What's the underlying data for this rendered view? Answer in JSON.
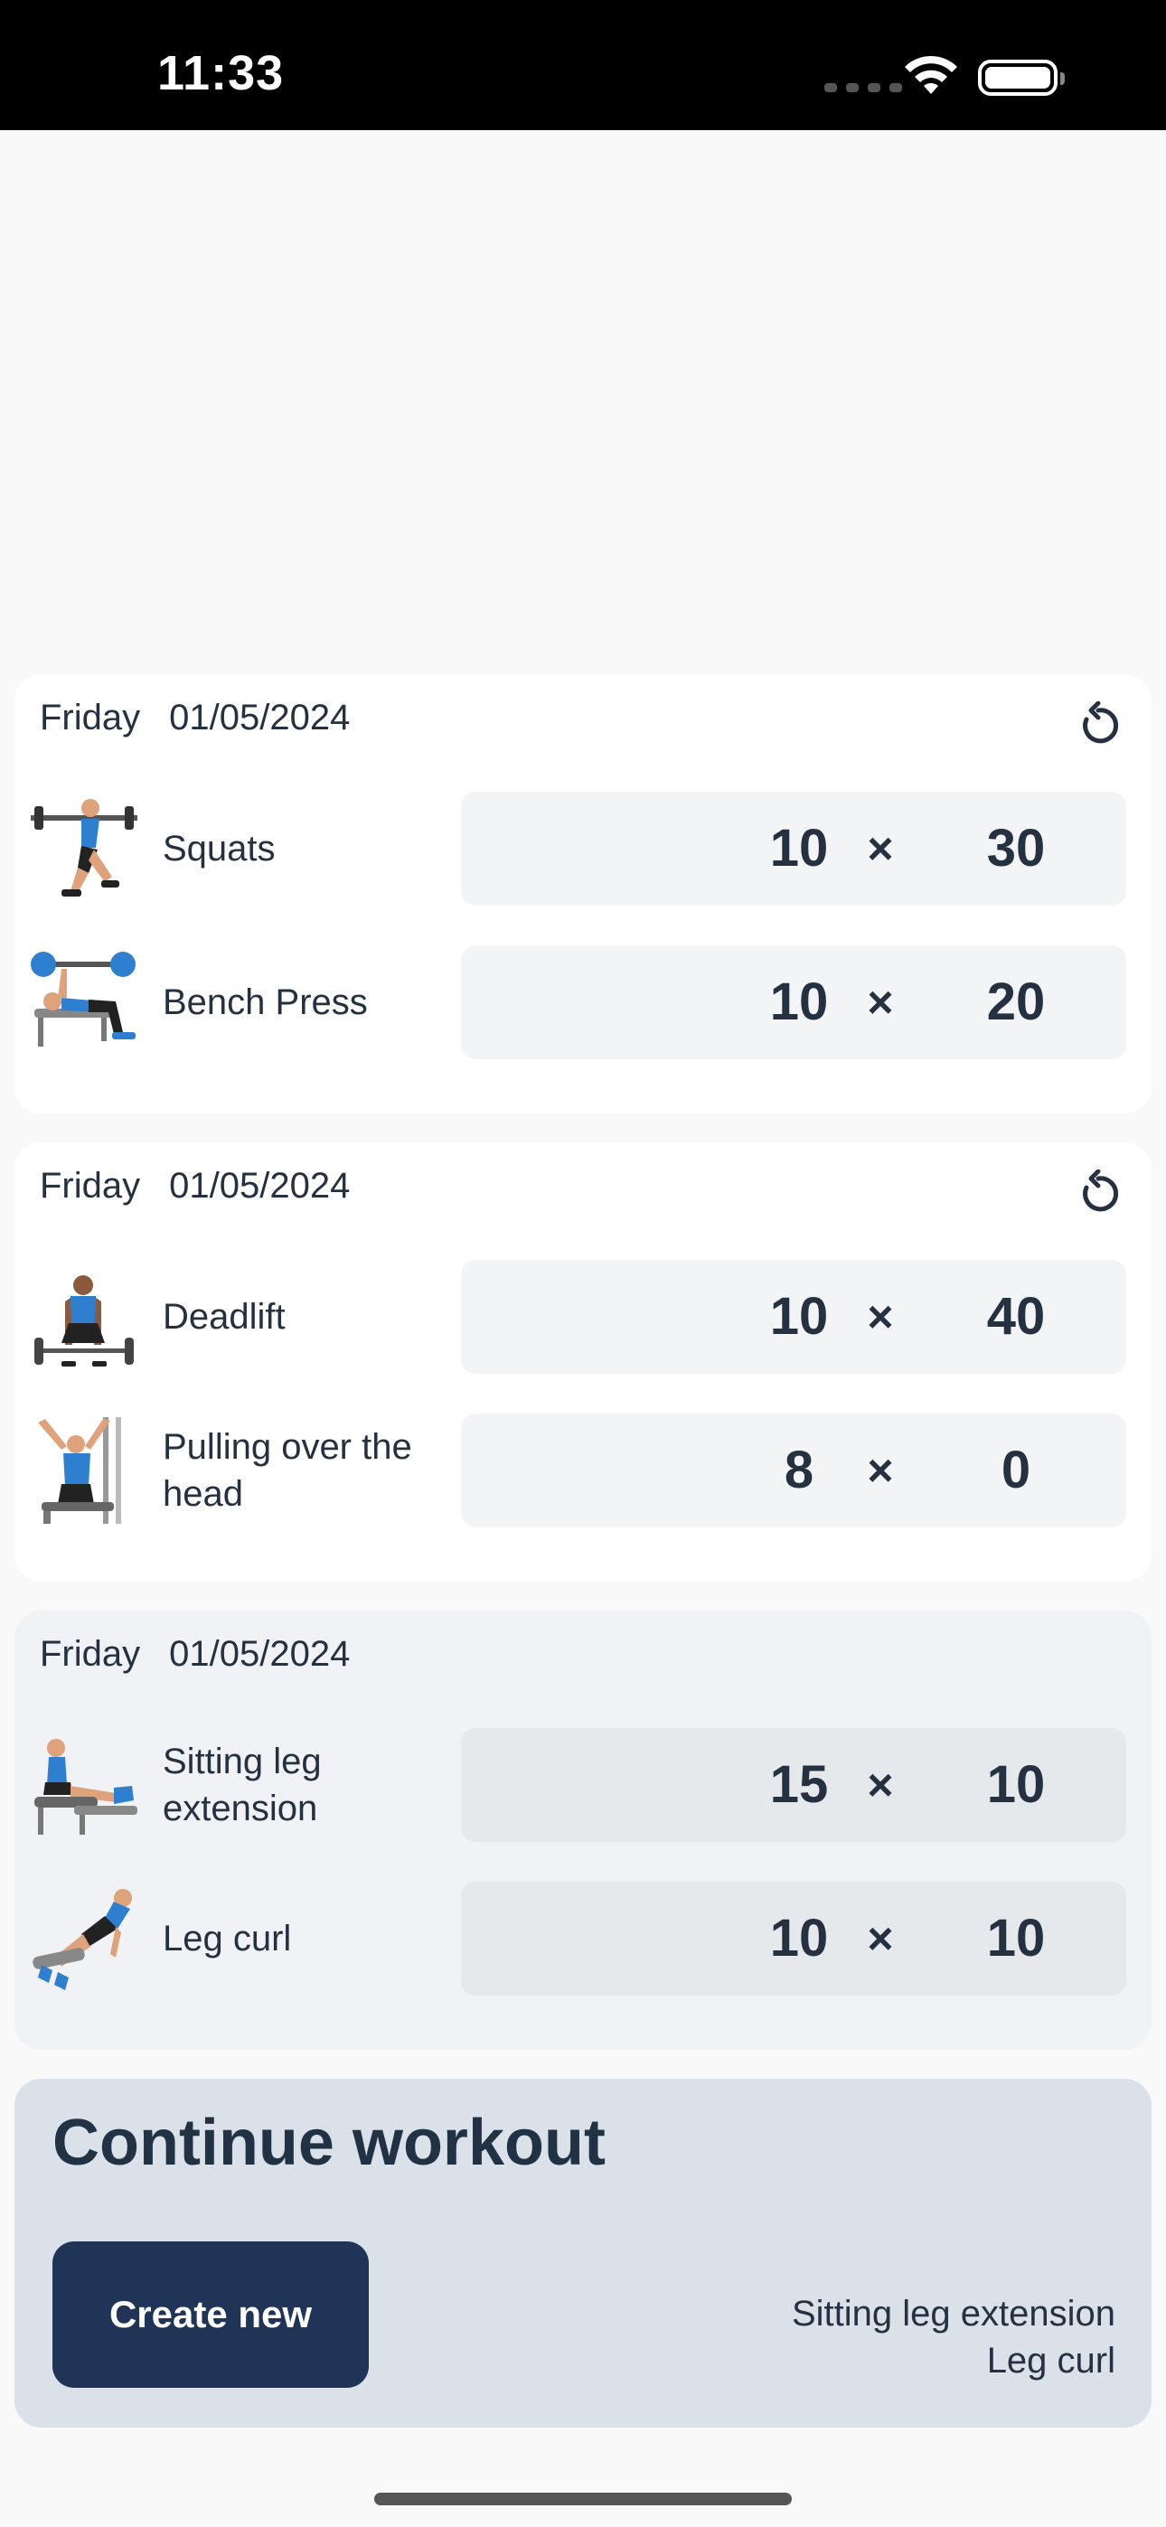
{
  "status_bar": {
    "time": "11:33"
  },
  "workouts": [
    {
      "day": "Friday",
      "date": "01/05/2024",
      "show_reset": true,
      "exercises": [
        {
          "name": "Squats",
          "reps": "10",
          "weight": "30",
          "icon": "squat-figure-icon"
        },
        {
          "name": "Bench Press",
          "reps": "10",
          "weight": "20",
          "icon": "bench-press-figure-icon"
        }
      ]
    },
    {
      "day": "Friday",
      "date": "01/05/2024",
      "show_reset": true,
      "exercises": [
        {
          "name": "Deadlift",
          "reps": "10",
          "weight": "40",
          "icon": "deadlift-figure-icon"
        },
        {
          "name": "Pulling over the head",
          "reps": "8",
          "weight": "0",
          "icon": "pulldown-figure-icon"
        }
      ]
    },
    {
      "day": "Friday",
      "date": "01/05/2024",
      "show_reset": false,
      "exercises": [
        {
          "name": "Sitting leg extension",
          "reps": "15",
          "weight": "10",
          "icon": "leg-extension-figure-icon"
        },
        {
          "name": "Leg curl",
          "reps": "10",
          "weight": "10",
          "icon": "leg-curl-figure-icon"
        }
      ]
    }
  ],
  "times_symbol": "×",
  "continue": {
    "title": "Continue workout",
    "create_button": "Create new",
    "exercises": [
      "Sitting leg extension",
      "Leg curl"
    ]
  },
  "colors": {
    "accent": "#1f3456",
    "text": "#253141",
    "athlete_blue": "#2f7fd1"
  }
}
